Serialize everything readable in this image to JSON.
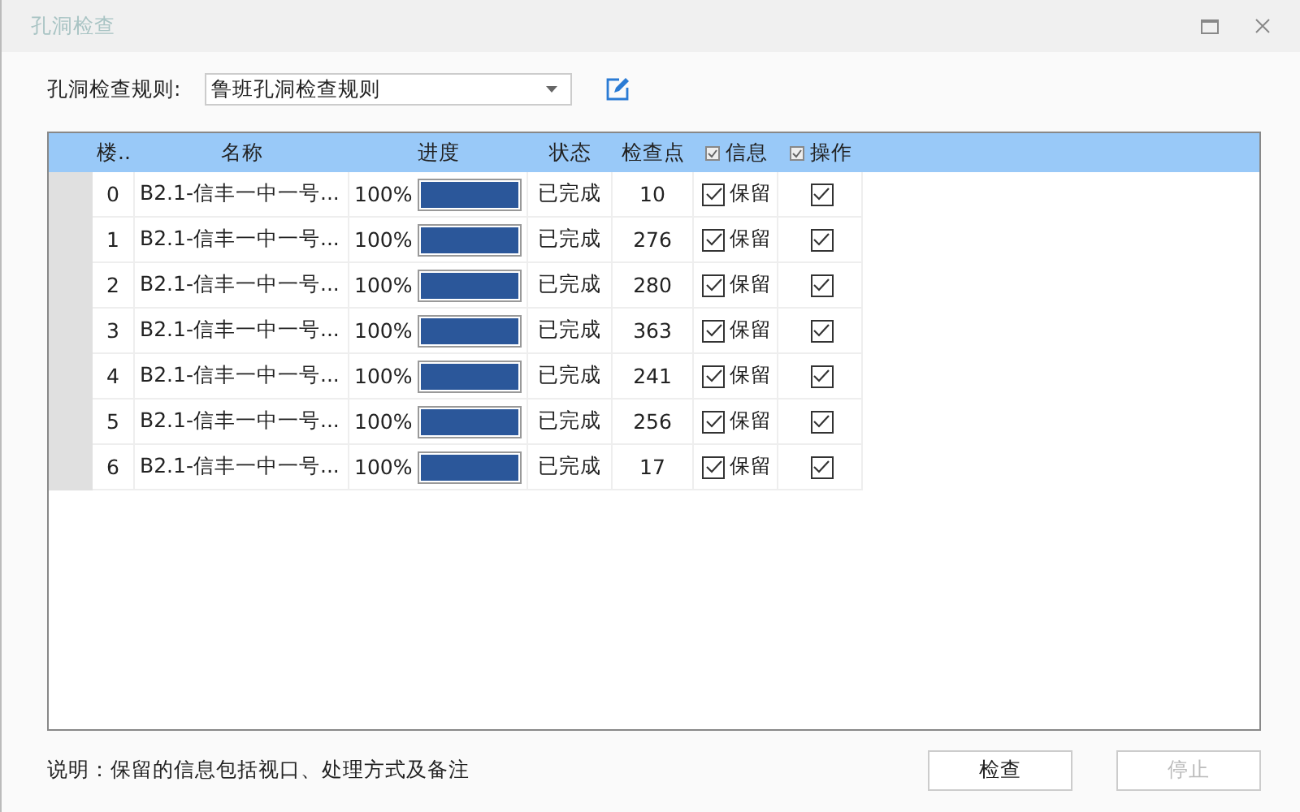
{
  "window": {
    "title": "孔洞检查"
  },
  "rule": {
    "label": "孔洞检查规则:",
    "value": "鲁班孔洞检查规则"
  },
  "table": {
    "columns": [
      {
        "label": "楼..",
        "kind": "text"
      },
      {
        "label": "名称",
        "kind": "text"
      },
      {
        "label": "进度",
        "kind": "text"
      },
      {
        "label": "状态",
        "kind": "text"
      },
      {
        "label": "检查点",
        "kind": "text"
      },
      {
        "label": "信息",
        "kind": "check",
        "checked": true
      },
      {
        "label": "操作",
        "kind": "check",
        "checked": true
      }
    ],
    "rows": [
      {
        "floor": "0",
        "name": "B2.1-信丰一中一号...",
        "percent": "100%",
        "level": 1,
        "status": "已完成",
        "points": "10",
        "info_checked": true,
        "info_label": "保留",
        "op_checked": true
      },
      {
        "floor": "1",
        "name": "B2.1-信丰一中一号...",
        "percent": "100%",
        "level": 1,
        "status": "已完成",
        "points": "276",
        "info_checked": true,
        "info_label": "保留",
        "op_checked": true
      },
      {
        "floor": "2",
        "name": "B2.1-信丰一中一号...",
        "percent": "100%",
        "level": 1,
        "status": "已完成",
        "points": "280",
        "info_checked": true,
        "info_label": "保留",
        "op_checked": true
      },
      {
        "floor": "3",
        "name": "B2.1-信丰一中一号...",
        "percent": "100%",
        "level": 1,
        "status": "已完成",
        "points": "363",
        "info_checked": true,
        "info_label": "保留",
        "op_checked": true
      },
      {
        "floor": "4",
        "name": "B2.1-信丰一中一号...",
        "percent": "100%",
        "level": 1,
        "status": "已完成",
        "points": "241",
        "info_checked": true,
        "info_label": "保留",
        "op_checked": true
      },
      {
        "floor": "5",
        "name": "B2.1-信丰一中一号...",
        "percent": "100%",
        "level": 1,
        "status": "已完成",
        "points": "256",
        "info_checked": true,
        "info_label": "保留",
        "op_checked": true
      },
      {
        "floor": "6",
        "name": "B2.1-信丰一中一号...",
        "percent": "100%",
        "level": 1,
        "status": "已完成",
        "points": "17",
        "info_checked": true,
        "info_label": "保留",
        "op_checked": true
      }
    ]
  },
  "note": "说明：保留的信息包括视口、处理方式及备注",
  "buttons": [
    {
      "label": "检查",
      "disabled": false
    },
    {
      "label": "停止",
      "disabled": true
    }
  ]
}
